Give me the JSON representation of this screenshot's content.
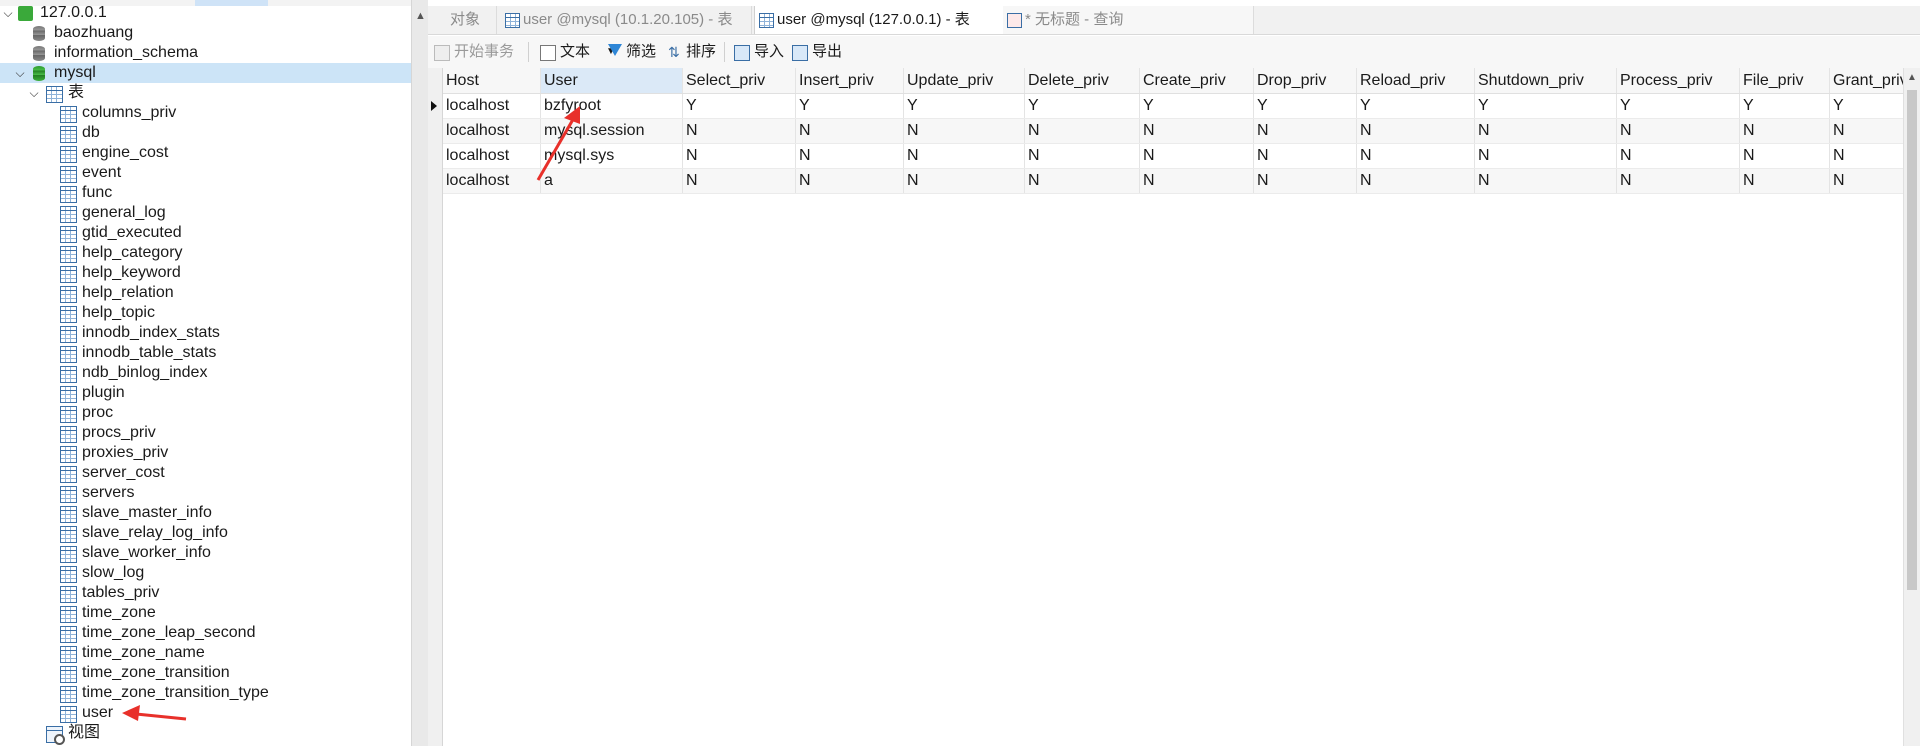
{
  "tree": {
    "server": {
      "label": "127.0.0.1"
    },
    "databases": [
      {
        "label": "baozhuang"
      },
      {
        "label": "information_schema"
      }
    ],
    "active_db": {
      "label": "mysql"
    },
    "tables_node": {
      "label": "表"
    },
    "tables": [
      "columns_priv",
      "db",
      "engine_cost",
      "event",
      "func",
      "general_log",
      "gtid_executed",
      "help_category",
      "help_keyword",
      "help_relation",
      "help_topic",
      "innodb_index_stats",
      "innodb_table_stats",
      "ndb_binlog_index",
      "plugin",
      "proc",
      "procs_priv",
      "proxies_priv",
      "server_cost",
      "servers",
      "slave_master_info",
      "slave_relay_log_info",
      "slave_worker_info",
      "slow_log",
      "tables_priv",
      "time_zone",
      "time_zone_leap_second",
      "time_zone_name",
      "time_zone_transition",
      "time_zone_transition_type",
      "user"
    ],
    "views_node": {
      "label": "视图"
    }
  },
  "tabs": [
    {
      "label": "对象",
      "icon": "none"
    },
    {
      "label": "user @mysql (10.1.20.105) - 表",
      "icon": "table-icon"
    },
    {
      "label": "user @mysql (127.0.0.1) - 表",
      "icon": "table-icon"
    },
    {
      "label": "* 无标题 - 查询",
      "icon": "query-icon"
    }
  ],
  "active_tab_index": 2,
  "toolbar": {
    "begin_transaction": "开始事务",
    "text": "文本",
    "filter": "筛选",
    "sort": "排序",
    "import": "导入",
    "export": "导出"
  },
  "grid": {
    "columns": [
      "Host",
      "User",
      "Select_priv",
      "Insert_priv",
      "Update_priv",
      "Delete_priv",
      "Create_priv",
      "Drop_priv",
      "Reload_priv",
      "Shutdown_priv",
      "Process_priv",
      "File_priv",
      "Grant_priv"
    ],
    "rows": [
      [
        "localhost",
        "bzfyroot",
        "Y",
        "Y",
        "Y",
        "Y",
        "Y",
        "Y",
        "Y",
        "Y",
        "Y",
        "Y",
        "Y"
      ],
      [
        "localhost",
        "mysql.session",
        "N",
        "N",
        "N",
        "N",
        "N",
        "N",
        "N",
        "N",
        "N",
        "N",
        "N"
      ],
      [
        "localhost",
        "mysql.sys",
        "N",
        "N",
        "N",
        "N",
        "N",
        "N",
        "N",
        "N",
        "N",
        "N",
        "N"
      ],
      [
        "localhost",
        "a",
        "N",
        "N",
        "N",
        "N",
        "N",
        "N",
        "N",
        "N",
        "N",
        "N",
        "N"
      ]
    ],
    "selected_header": "User",
    "current_row": 0
  },
  "colors": {
    "selection": "#cce4f7",
    "annotation_arrow": "#e8302a"
  }
}
